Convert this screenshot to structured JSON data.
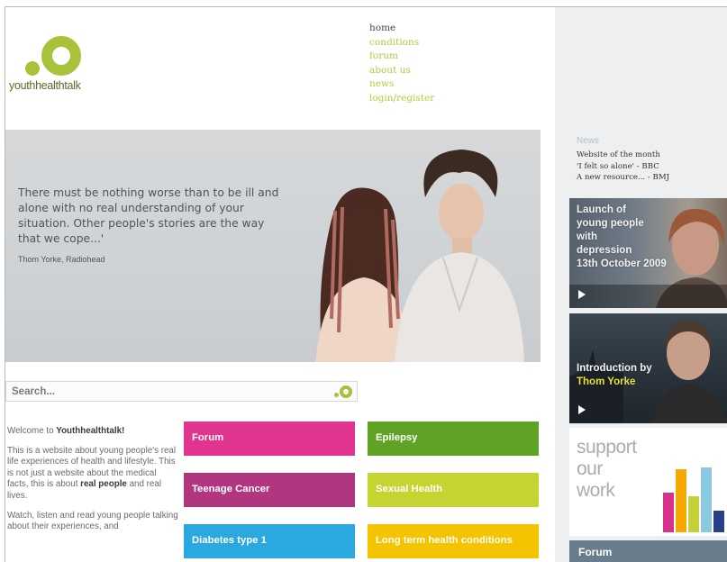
{
  "logo": {
    "text": "youthhealthtalk"
  },
  "nav": {
    "home": "home",
    "conditions": "conditions",
    "forum": "forum",
    "about": "about us",
    "news": "news",
    "login": "login/register"
  },
  "hero": {
    "quote": "There must be nothing worse than to be ill and alone with no real understanding of your situation. Other people's stories are the way that we cope...'",
    "attribution": "Thom Yorke, Radiohead"
  },
  "search": {
    "placeholder": "Search..."
  },
  "welcome": {
    "intro_prefix": "Welcome to ",
    "intro_site": "Youthhealthtalk!",
    "p2_a": "This is a website about young people's real life experiences of health and lifestyle. This is not just a website about the medical facts, this is about ",
    "p2_bold": "real people",
    "p2_b": " and real lives.",
    "p3": "Watch, listen and read young people talking about their experiences, and"
  },
  "tiles": [
    {
      "label": "Forum",
      "color": "#e0358f"
    },
    {
      "label": "Epilepsy",
      "color": "#5ea324"
    },
    {
      "label": "Teenage Cancer",
      "color": "#b2357f"
    },
    {
      "label": "Sexual Health",
      "color": "#c6d432"
    },
    {
      "label": "Diabetes type 1",
      "color": "#2aa8df"
    },
    {
      "label": "Long term health conditions",
      "color": "#f5c400"
    }
  ],
  "news": {
    "heading": "News",
    "items": [
      "Website of the month",
      "'I felt so alone' - BBC",
      "A new resource... - BMJ"
    ]
  },
  "videos": [
    {
      "lines": [
        "Launch of",
        "young people",
        "with",
        "depression",
        "13th October 2009"
      ]
    },
    {
      "line1": "Introduction by",
      "line2": "Thom Yorke"
    }
  ],
  "support": {
    "l1": "support",
    "l2": "our",
    "l3": "work"
  },
  "forum_box": {
    "label": "Forum"
  }
}
